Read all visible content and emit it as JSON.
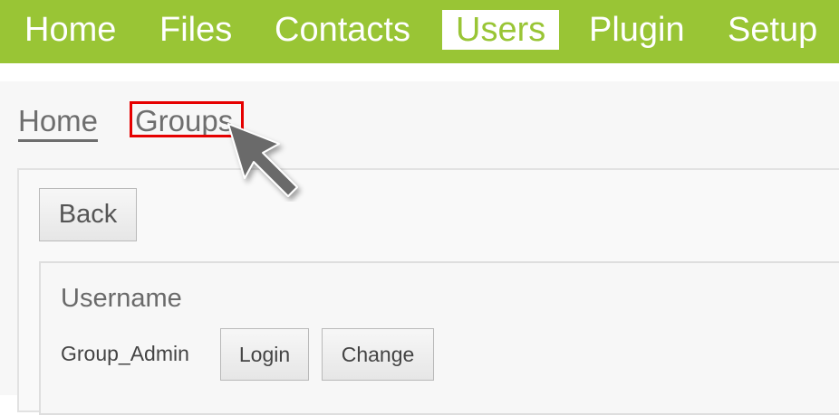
{
  "nav": {
    "items": [
      {
        "label": "Home"
      },
      {
        "label": "Files"
      },
      {
        "label": "Contacts"
      },
      {
        "label": "Users",
        "active": true
      },
      {
        "label": "Plugin"
      },
      {
        "label": "Setup"
      }
    ]
  },
  "tabs": {
    "items": [
      {
        "label": "Home",
        "current": true
      },
      {
        "label": "Groups",
        "highlighted": true
      }
    ]
  },
  "panel": {
    "back_label": "Back",
    "section_title": "Username",
    "row": {
      "username": "Group_Admin",
      "login_label": "Login",
      "change_label": "Change"
    }
  },
  "colors": {
    "nav_background": "#99c535",
    "highlight": "#e60000",
    "cursor": "#6b6b6b"
  }
}
